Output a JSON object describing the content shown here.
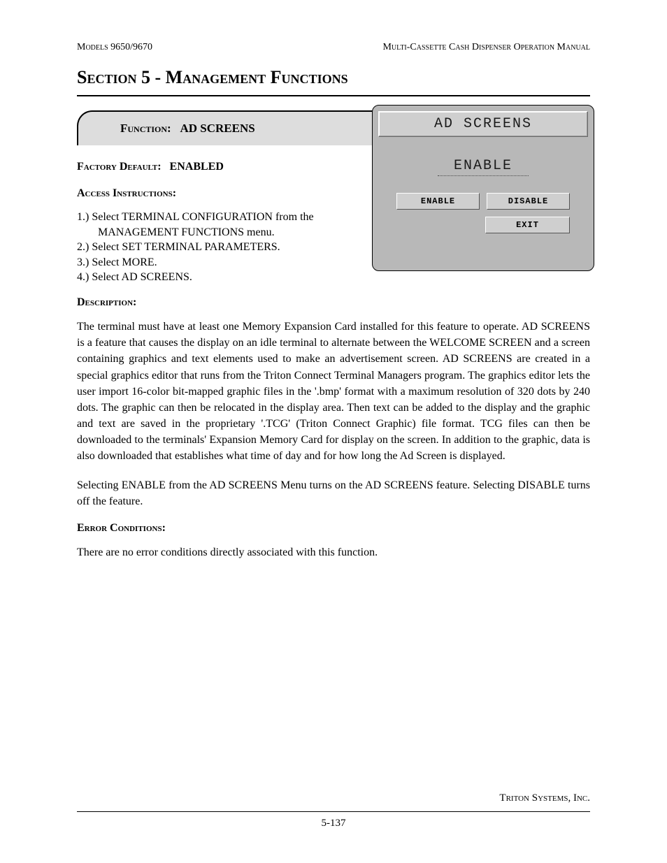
{
  "header": {
    "left": "Models 9650/9670",
    "right": "Multi-Cassette Cash Dispenser Operation Manual"
  },
  "section_title": "Section 5 - Management Functions",
  "function_box": {
    "label": "Function:",
    "name": "AD SCREENS"
  },
  "factory_default": {
    "label": "Factory Default:",
    "value": "ENABLED"
  },
  "access_instructions_label": "Access Instructions:",
  "steps": [
    "1.) Select TERMINAL CONFIGURATION from the MANAGEMENT FUNCTIONS menu.",
    "2.) Select SET TERMINAL PARAMETERS.",
    "3.) Select MORE.",
    "4.) Select AD SCREENS."
  ],
  "description_label": "Description:",
  "description_p1": "The terminal must have at least one Memory Expansion Card installed for this feature to operate. AD SCREENS is a feature that causes the display on an idle terminal to alternate between the WELCOME SCREEN and a screen containing graphics and text elements used to make an advertisement screen. AD SCREENS are created in a special graphics editor that runs from the Triton Connect Terminal Managers program. The graphics editor lets the user import 16-color bit-mapped graphic files in the '.bmp' format with a maximum resolution of 320 dots by 240 dots. The graphic can then be relocated in the display area. Then text can be added to the display and the graphic and text are saved in the proprietary '.TCG' (Triton Connect Graphic) file format. TCG files can then be downloaded to the terminals' Expansion Memory Card for display on the screen. In addition to the graphic, data is also downloaded that establishes what time of day and for how long the Ad Screen is displayed.",
  "description_p2": "Selecting ENABLE from the AD SCREENS Menu turns on the AD SCREENS feature. Selecting DISABLE turns off the feature.",
  "error_label": "Error Conditions:",
  "error_text": "There are no error conditions directly associated with this function.",
  "terminal": {
    "title": "AD SCREENS",
    "status": "ENABLE",
    "btn_enable": "ENABLE",
    "btn_disable": "DISABLE",
    "btn_exit": "EXIT"
  },
  "footer": {
    "company": "Triton Systems, Inc.",
    "page": "5-137"
  }
}
